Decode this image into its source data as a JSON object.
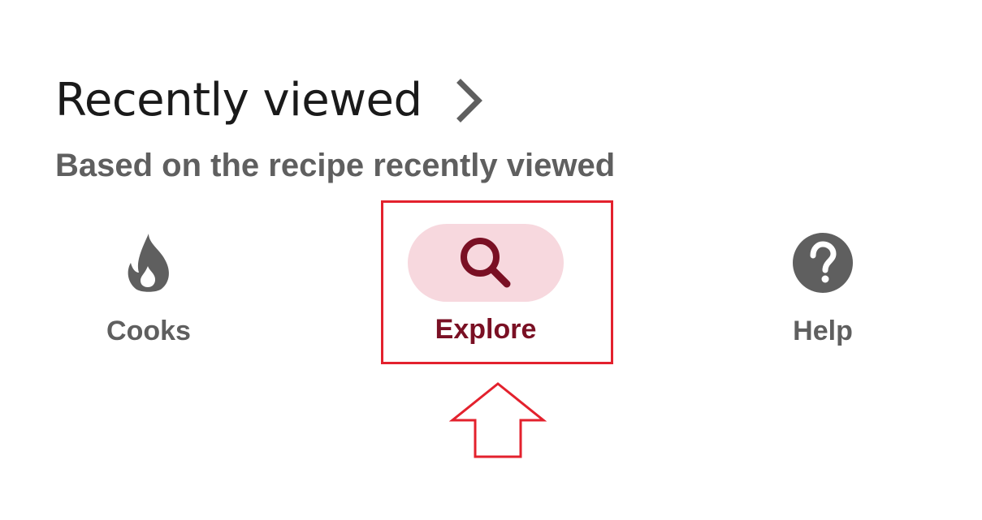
{
  "section": {
    "title": "Recently viewed",
    "subtitle": "Based on the recipe recently viewed"
  },
  "nav": {
    "items": [
      {
        "label": "Cooks",
        "icon": "flame-icon",
        "color": "#5f5f5f",
        "selected": false
      },
      {
        "label": "Explore",
        "icon": "search-icon",
        "color": "#7a1024",
        "selected": true,
        "pill_color": "#f7d8de"
      },
      {
        "label": "Help",
        "icon": "help-icon",
        "color": "#5f5f5f",
        "selected": false
      }
    ]
  },
  "annotation": {
    "highlight_color": "#e3212d",
    "arrow_direction": "up"
  }
}
